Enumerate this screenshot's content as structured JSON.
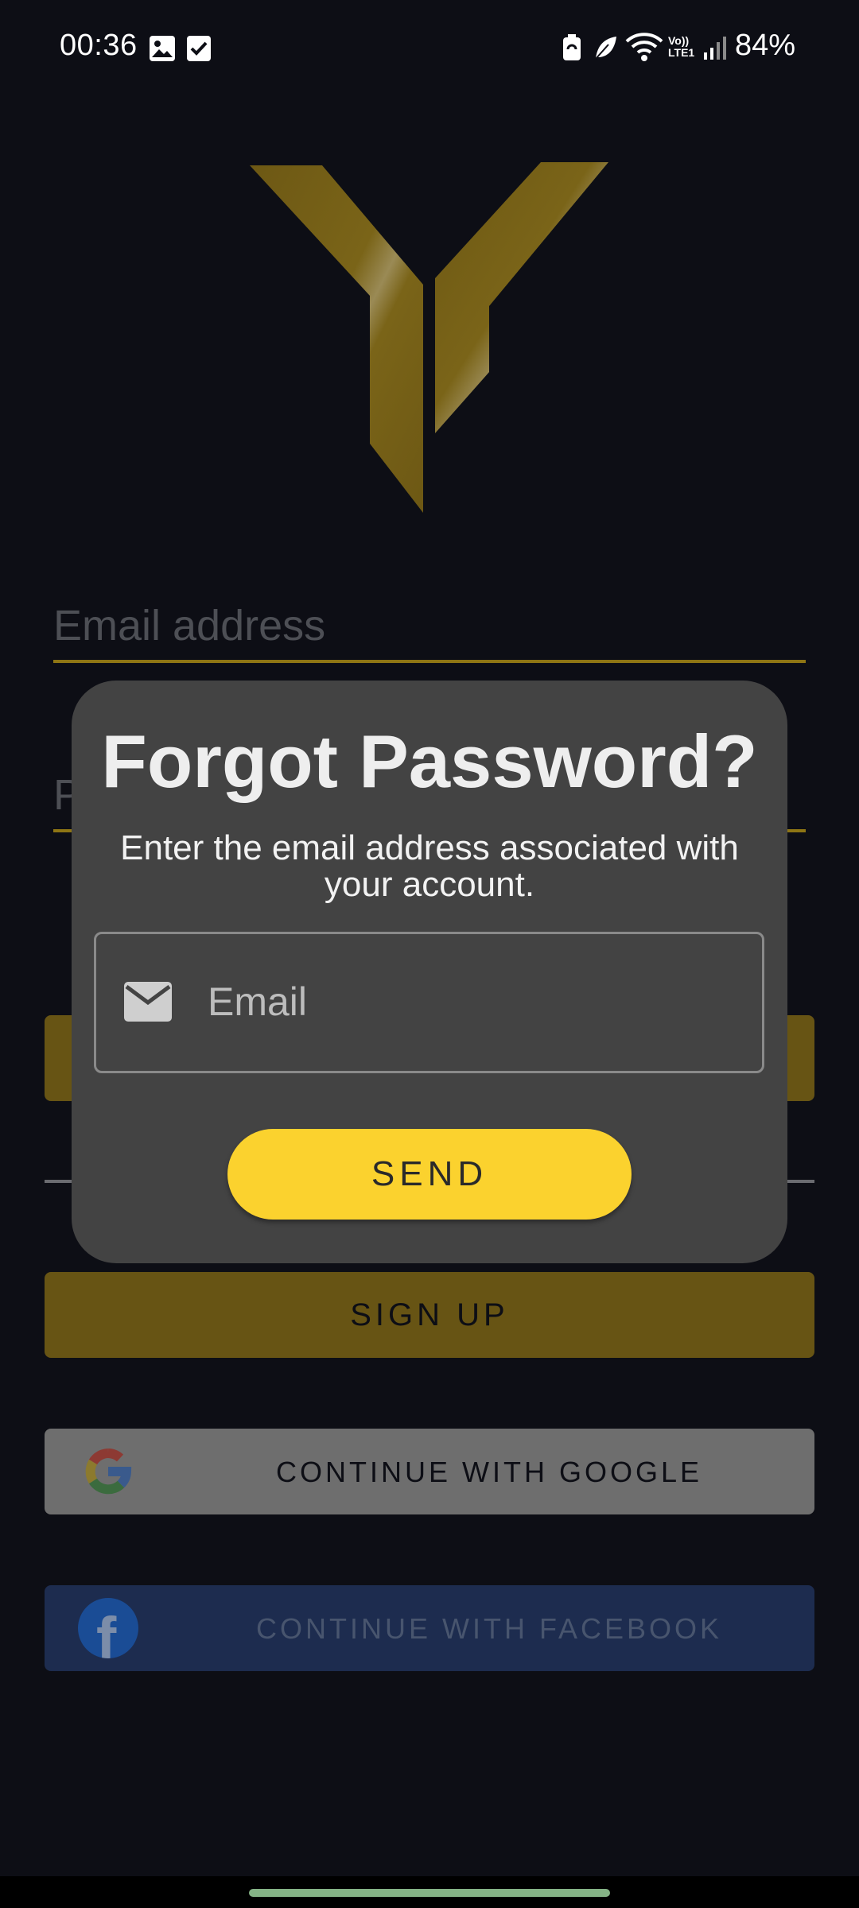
{
  "status_bar": {
    "time": "00:36",
    "battery": "84%",
    "network_label": "Vo)) LTE1",
    "left_icons": [
      "image-icon",
      "checkbox-icon"
    ],
    "right_icons": [
      "battery-saver-icon",
      "leaf-icon",
      "wifi-icon",
      "volte-icon",
      "signal-icon"
    ]
  },
  "login": {
    "email_label": "Email address",
    "password_label": "P",
    "signup_label": "SIGN UP",
    "google_label": "CONTINUE WITH GOOGLE",
    "facebook_label": "CONTINUE WITH FACEBOOK",
    "facebook_glyph": "f"
  },
  "dialog": {
    "title": "Forgot Password?",
    "subtitle": "Enter the email address associated with your account.",
    "email_placeholder": "Email",
    "send_label": "SEND"
  },
  "colors": {
    "background": "#0d0e15",
    "accent": "#fbd22e",
    "dialog": "#434343",
    "logo_gold": "#7a6418"
  }
}
